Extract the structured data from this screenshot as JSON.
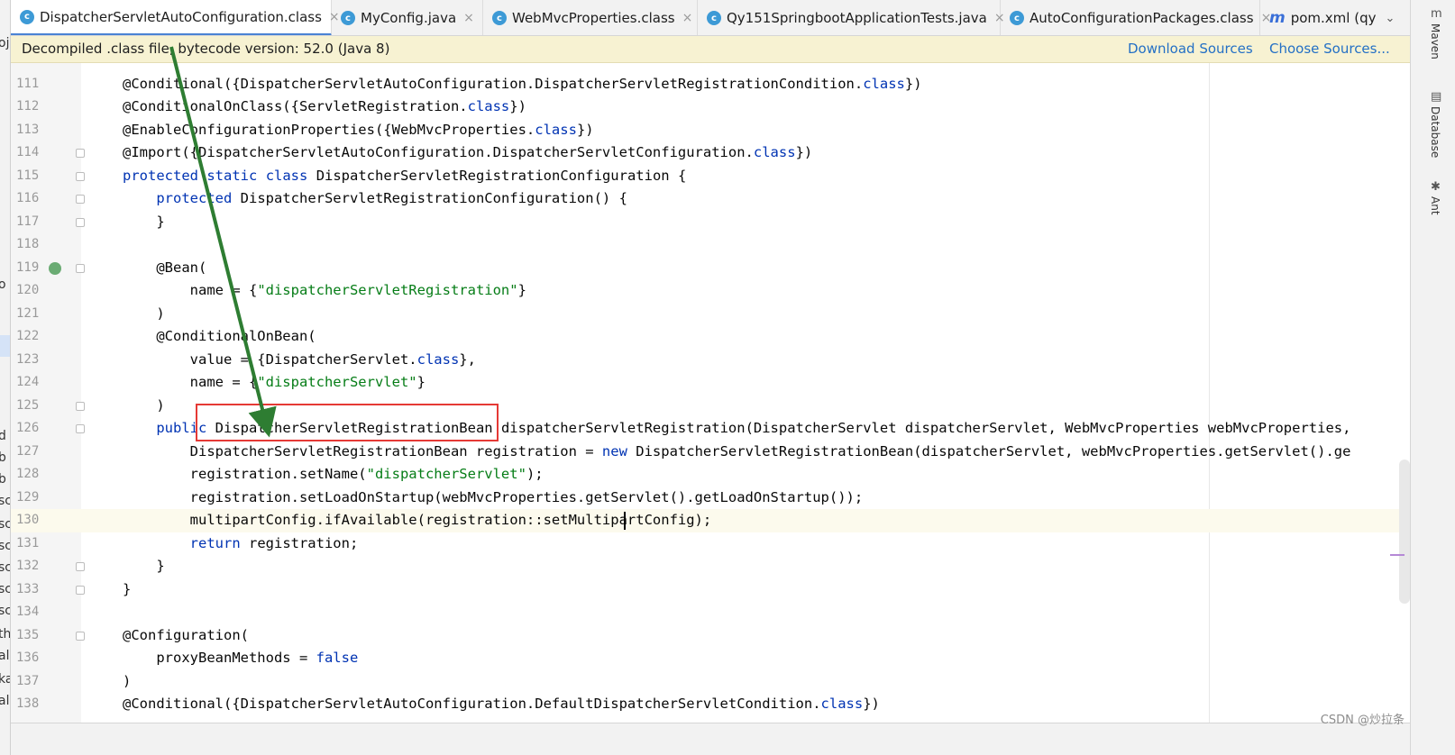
{
  "tabs": [
    {
      "label": "DispatcherServletAutoConfiguration.class",
      "icon": "class-icon",
      "active": true
    },
    {
      "label": "MyConfig.java",
      "icon": "class-icon",
      "active": false
    },
    {
      "label": "WebMvcProperties.class",
      "icon": "class-icon",
      "active": false
    },
    {
      "label": "Qy151SpringbootApplicationTests.java",
      "icon": "class-icon",
      "active": false
    },
    {
      "label": "AutoConfigurationPackages.class",
      "icon": "class-icon",
      "active": false
    },
    {
      "label": "pom.xml (qy",
      "icon": "maven-icon",
      "active": false
    }
  ],
  "tab_close_glyph": "×",
  "tab_overflow_glyph": "⌄",
  "banner": {
    "message": "Decompiled .class file, bytecode version: 52.0 (Java 8)",
    "download_sources": "Download Sources",
    "choose_sources": "Choose Sources..."
  },
  "right_tools": [
    "Maven",
    "Database",
    "Ant"
  ],
  "left_fragments": [
    "oj",
    "o",
    "d",
    "b",
    "b",
    "sc",
    "sc",
    "sc",
    "sc",
    "sc",
    "sc",
    "th",
    "al.",
    "ka",
    "al"
  ],
  "current_line": 130,
  "code_lines": [
    {
      "n": "111",
      "parts": [
        [
          "@Conditional({DispatcherServletAutoConfiguration.DispatcherServletRegistrationCondition.",
          ""
        ],
        [
          "class",
          "kw"
        ],
        [
          "})",
          ""
        ]
      ]
    },
    {
      "n": "112",
      "parts": [
        [
          "@ConditionalOnClass({ServletRegistration.",
          ""
        ],
        [
          "class",
          "kw"
        ],
        [
          "})",
          ""
        ]
      ]
    },
    {
      "n": "113",
      "parts": [
        [
          "@EnableConfigurationProperties({WebMvcProperties.",
          ""
        ],
        [
          "class",
          "kw"
        ],
        [
          "})",
          ""
        ]
      ]
    },
    {
      "n": "114",
      "parts": [
        [
          "@Import({DispatcherServletAutoConfiguration.DispatcherServletConfiguration.",
          ""
        ],
        [
          "class",
          "kw"
        ],
        [
          "})",
          ""
        ]
      ]
    },
    {
      "n": "115",
      "parts": [
        [
          "protected",
          "kw"
        ],
        [
          " ",
          ""
        ],
        [
          "static",
          "kw"
        ],
        [
          " ",
          ""
        ],
        [
          "class",
          "kw"
        ],
        [
          " DispatcherServletRegistrationConfiguration {",
          ""
        ]
      ]
    },
    {
      "n": "116",
      "parts": [
        [
          "    ",
          ""
        ],
        [
          "protected",
          "kw"
        ],
        [
          " DispatcherServletRegistrationConfiguration() {",
          ""
        ]
      ]
    },
    {
      "n": "117",
      "parts": [
        [
          "    }",
          ""
        ]
      ]
    },
    {
      "n": "118",
      "parts": []
    },
    {
      "n": "119",
      "parts": [
        [
          "    @Bean(",
          ""
        ]
      ]
    },
    {
      "n": "120",
      "parts": [
        [
          "        name = {",
          ""
        ],
        [
          "\"dispatcherServletRegistration\"",
          "str"
        ],
        [
          "}",
          ""
        ]
      ]
    },
    {
      "n": "121",
      "parts": [
        [
          "    )",
          ""
        ]
      ]
    },
    {
      "n": "122",
      "parts": [
        [
          "    @ConditionalOnBean(",
          ""
        ]
      ]
    },
    {
      "n": "123",
      "parts": [
        [
          "        value = {DispatcherServlet.",
          ""
        ],
        [
          "class",
          "kw"
        ],
        [
          "},",
          ""
        ]
      ]
    },
    {
      "n": "124",
      "parts": [
        [
          "        name = {",
          ""
        ],
        [
          "\"dispatcherServlet\"",
          "str"
        ],
        [
          "}",
          ""
        ]
      ]
    },
    {
      "n": "125",
      "parts": [
        [
          "    )",
          ""
        ]
      ]
    },
    {
      "n": "126",
      "parts": [
        [
          "    ",
          ""
        ],
        [
          "public",
          "kw"
        ],
        [
          " DispatcherServletRegistrationBean dispatcherServletRegistration(DispatcherServlet dispatcherServlet, WebMvcProperties webMvcProperties,",
          ""
        ]
      ]
    },
    {
      "n": "127",
      "parts": [
        [
          "        DispatcherServletRegistrationBean registration = ",
          ""
        ],
        [
          "new",
          "kw"
        ],
        [
          " DispatcherServletRegistrationBean(dispatcherServlet, webMvcProperties.getServlet().ge",
          ""
        ]
      ]
    },
    {
      "n": "128",
      "parts": [
        [
          "        registration.setName(",
          ""
        ],
        [
          "\"dispatcherServlet\"",
          "str"
        ],
        [
          ");",
          ""
        ]
      ]
    },
    {
      "n": "129",
      "parts": [
        [
          "        registration.setLoadOnStartup(webMvcProperties.getServlet().getLoadOnStartup());",
          ""
        ]
      ]
    },
    {
      "n": "130",
      "parts": [
        [
          "        multipartConfig.ifAvailable(registration::setMultipartConfig);",
          ""
        ]
      ]
    },
    {
      "n": "131",
      "parts": [
        [
          "        ",
          ""
        ],
        [
          "return",
          "kw"
        ],
        [
          " registration;",
          ""
        ]
      ]
    },
    {
      "n": "132",
      "parts": [
        [
          "    }",
          ""
        ]
      ]
    },
    {
      "n": "133",
      "parts": [
        [
          "}",
          ""
        ]
      ]
    },
    {
      "n": "134",
      "parts": []
    },
    {
      "n": "135",
      "parts": [
        [
          "@Configuration(",
          ""
        ]
      ]
    },
    {
      "n": "136",
      "parts": [
        [
          "    proxyBeanMethods = ",
          ""
        ],
        [
          "false",
          "kw"
        ]
      ]
    },
    {
      "n": "137",
      "parts": [
        [
          ")",
          ""
        ]
      ]
    },
    {
      "n": "138",
      "parts": [
        [
          "@Conditional({DispatcherServletAutoConfiguration.DefaultDispatcherServletCondition.",
          ""
        ],
        [
          "class",
          "kw"
        ],
        [
          "})",
          ""
        ]
      ]
    }
  ],
  "annotation": {
    "highlighted_text": "DispatcherServletRegistrationBean",
    "box_color": "#e53935",
    "arrow_color": "#2e7d32"
  },
  "colors": {
    "keyword": "#0033b3",
    "string": "#067d17",
    "tab_accent": "#4a83d4",
    "banner_bg": "#f7f2d2",
    "link": "#2470c5"
  },
  "watermark": "CSDN @炒拉条"
}
